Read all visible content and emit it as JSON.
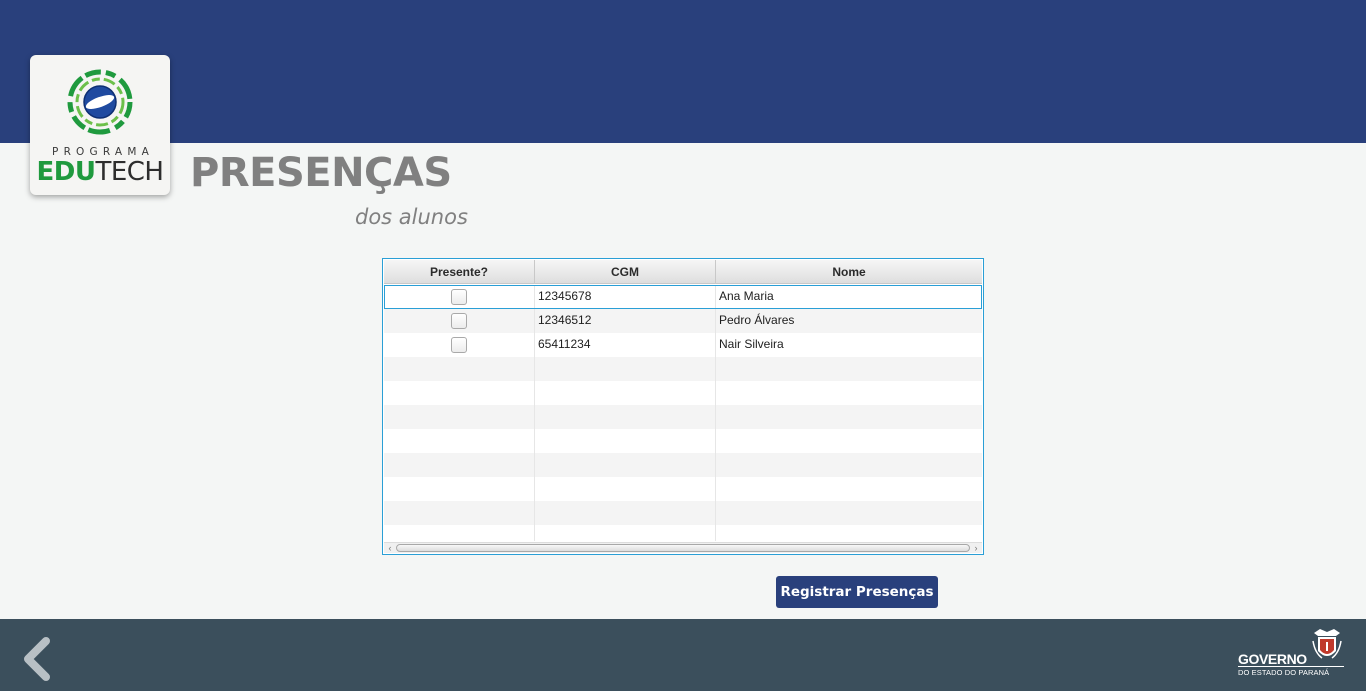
{
  "brand": {
    "program_label": "PROGRAMA",
    "name_part1": "EDU",
    "name_part2": "TECH"
  },
  "page": {
    "title": "PRESENÇAS",
    "subtitle": "dos alunos"
  },
  "table": {
    "columns": [
      "Presente?",
      "CGM",
      "Nome"
    ],
    "rows": [
      {
        "present": false,
        "cgm": "12345678",
        "nome": "Ana Maria"
      },
      {
        "present": false,
        "cgm": "12346512",
        "nome": "Pedro Álvares"
      },
      {
        "present": false,
        "cgm": "65411234",
        "nome": "Nair Silveira"
      }
    ],
    "selected_row": 0
  },
  "actions": {
    "register_label": "Registrar Presenças"
  },
  "footer": {
    "gov_title": "GOVERNO",
    "gov_subtitle": "DO ESTADO DO PARANÁ"
  },
  "icons": {
    "back": "chevron-left-icon",
    "checkbox": "checkbox-unchecked"
  },
  "colors": {
    "header": "#29407c",
    "footer": "#3b4f5c",
    "accent": "#2a9fd6",
    "button": "#29407c",
    "brand_green": "#1f9a3e"
  }
}
